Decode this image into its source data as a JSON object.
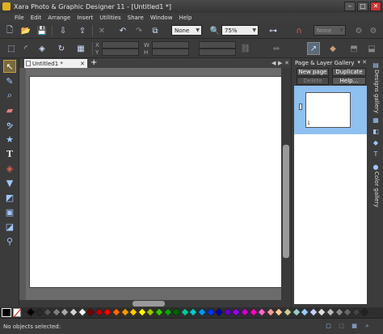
{
  "window": {
    "title": "Xara Photo & Graphic Designer 11 - [Untitled1 *]"
  },
  "menu": [
    "File",
    "Edit",
    "Arrange",
    "Insert",
    "Utilities",
    "Share",
    "Window",
    "Help"
  ],
  "toolbar": {
    "quality_value": "None",
    "zoom_value": "75%",
    "disabled_combo_value": "None",
    "x_label": "X",
    "y_label": "Y",
    "w_label": "W",
    "h_label": "H"
  },
  "document": {
    "tab_label": "Untitled1 *",
    "new_tab": "+"
  },
  "gallery": {
    "title": "Page & Layer Gallery",
    "new_page": "New page",
    "duplicate": "Duplicate",
    "delete": "Delete",
    "help": "Help...",
    "page_number": "1"
  },
  "side_tabs": {
    "designs": "Designs gallery",
    "color": "Color gallery"
  },
  "status": {
    "text": "No objects selected:"
  },
  "palette": {
    "colors": [
      "#000000",
      "#2a2a2a",
      "#555555",
      "#7f7f7f",
      "#aaaaaa",
      "#d4d4d4",
      "#ffffff",
      "#7a0000",
      "#c00000",
      "#ff0000",
      "#ff6a00",
      "#ff9900",
      "#ffcc00",
      "#ffff00",
      "#99cc00",
      "#33cc00",
      "#00aa00",
      "#006600",
      "#00cc99",
      "#00cccc",
      "#0099ff",
      "#0033ff",
      "#0000aa",
      "#6600cc",
      "#9900ff",
      "#cc00cc",
      "#ff00cc",
      "#ff66cc",
      "#ff9999",
      "#ffcc99",
      "#cccc99",
      "#99cccc",
      "#99ccff",
      "#ccccff",
      "#e0e0e0",
      "#bbbbbb",
      "#888888",
      "#666666",
      "#444444",
      "#222222"
    ]
  }
}
